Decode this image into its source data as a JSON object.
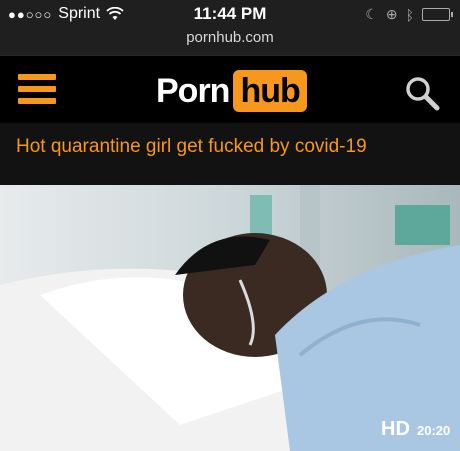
{
  "status_bar": {
    "signal": "●●○○○",
    "carrier": "Sprint",
    "time": "11:44 PM"
  },
  "browser": {
    "url": "pornhub.com"
  },
  "site": {
    "logo_part1": "Porn",
    "logo_part2": "hub",
    "accent_color": "#f7971d"
  },
  "video": {
    "title": "Hot quarantine girl get fucked by covid-19",
    "quality": "HD",
    "duration": "20:20"
  },
  "icons": [
    "wifi-icon",
    "moon-icon",
    "lock-rotation-icon",
    "bluetooth-icon",
    "battery-icon",
    "menu-icon",
    "search-icon"
  ]
}
